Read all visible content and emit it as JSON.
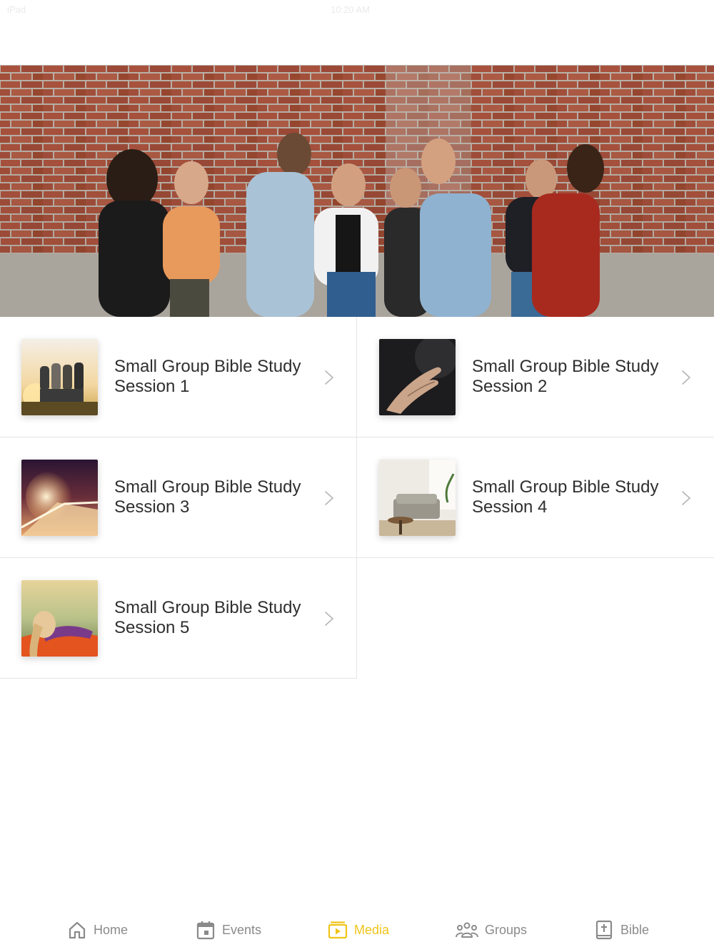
{
  "status_bar": {
    "carrier": "iPad",
    "time": "10:20 AM"
  },
  "hero": {
    "image": "group-of-friends-at-brick-wall"
  },
  "sessions": [
    {
      "title": "Small Group Bible Study Session 1",
      "thumbnail": "friends-at-sunset"
    },
    {
      "title": "Small Group Bible Study Session 2",
      "thumbnail": "open-hand"
    },
    {
      "title": "Small Group Bible Study Session 3",
      "thumbnail": "light-trails-road"
    },
    {
      "title": "Small Group Bible Study Session 4",
      "thumbnail": "living-room-sofa"
    },
    {
      "title": "Small Group Bible Study Session 5",
      "thumbnail": "person-in-hammock"
    }
  ],
  "tab_bar": {
    "tabs": [
      {
        "label": "Home",
        "icon": "home-icon"
      },
      {
        "label": "Events",
        "icon": "calendar-icon"
      },
      {
        "label": "Media",
        "icon": "media-icon"
      },
      {
        "label": "Groups",
        "icon": "groups-icon"
      },
      {
        "label": "Bible",
        "icon": "bible-icon"
      }
    ],
    "active": "Media"
  },
  "colors": {
    "accent": "#f0c419",
    "inactive": "#8a8a8a",
    "divider": "#e4e4e4"
  }
}
